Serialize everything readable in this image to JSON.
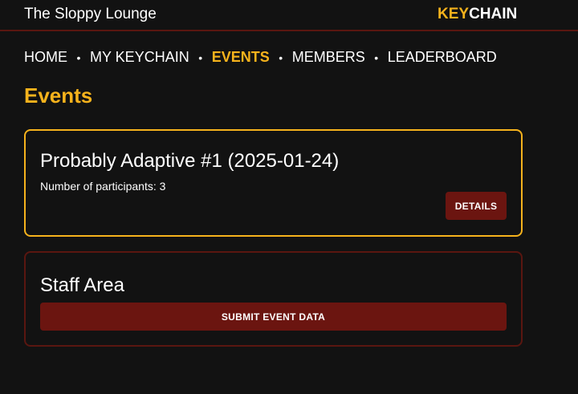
{
  "header": {
    "site_title": "The Sloppy Lounge",
    "brand_key": "KEY",
    "brand_chain": "CHAIN"
  },
  "nav": {
    "items": [
      {
        "label": "HOME",
        "active": false
      },
      {
        "label": "MY KEYCHAIN",
        "active": false
      },
      {
        "label": "EVENTS",
        "active": true
      },
      {
        "label": "MEMBERS",
        "active": false
      },
      {
        "label": "LEADERBOARD",
        "active": false
      }
    ],
    "separator": "•"
  },
  "page": {
    "title": "Events"
  },
  "events": [
    {
      "title": "Probably Adaptive #1 (2025-01-24)",
      "participants_text": "Number of participants: 3",
      "details_label": "DETAILS"
    }
  ],
  "staff": {
    "title": "Staff Area",
    "submit_label": "SUBMIT EVENT DATA"
  },
  "colors": {
    "background": "#121212",
    "accent": "#f5b21c",
    "button": "#6b1510",
    "staff_border": "#5a1610"
  }
}
